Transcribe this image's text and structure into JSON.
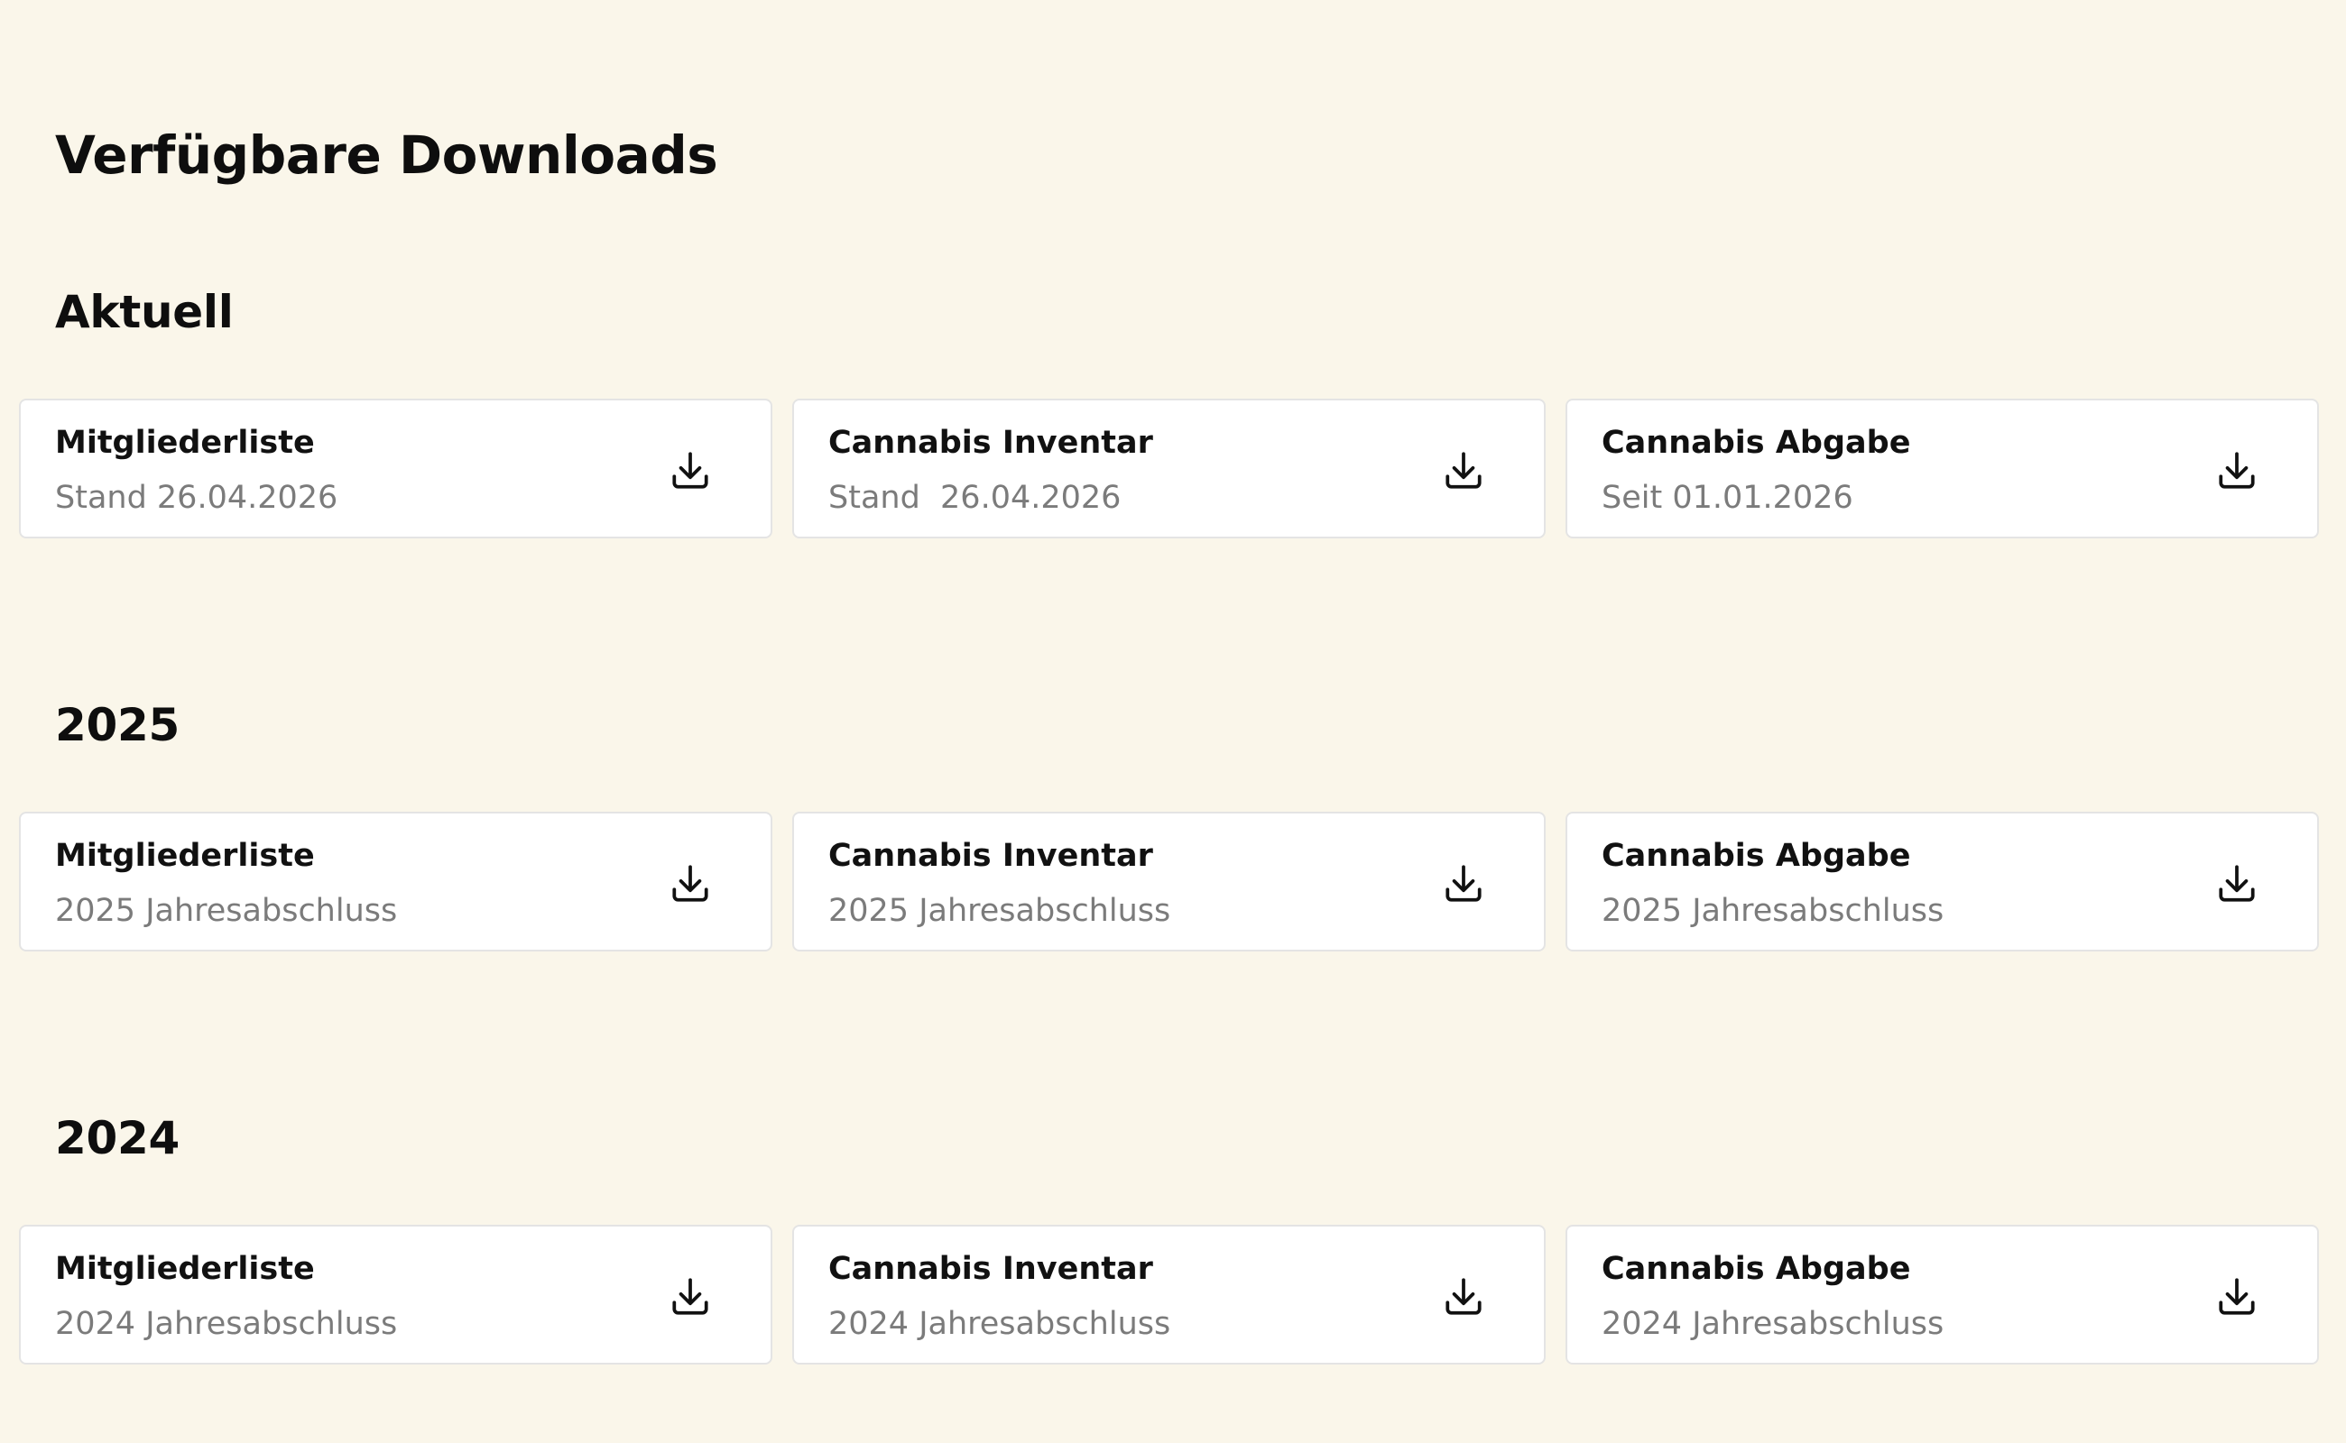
{
  "page": {
    "title": "Verfügbare Downloads"
  },
  "sections": [
    {
      "title": "Aktuell",
      "cards": [
        {
          "title": "Mitgliederliste",
          "subtitle": "Stand 26.04.2026",
          "icon": "download-icon"
        },
        {
          "title": "Cannabis Inventar",
          "subtitle": "Stand  26.04.2026",
          "icon": "download-icon"
        },
        {
          "title": "Cannabis Abgabe",
          "subtitle": "Seit 01.01.2026",
          "icon": "download-icon"
        }
      ]
    },
    {
      "title": "2025",
      "cards": [
        {
          "title": "Mitgliederliste",
          "subtitle": "2025 Jahresabschluss",
          "icon": "download-icon"
        },
        {
          "title": "Cannabis Inventar",
          "subtitle": "2025 Jahresabschluss",
          "icon": "download-icon"
        },
        {
          "title": "Cannabis Abgabe",
          "subtitle": "2025 Jahresabschluss",
          "icon": "download-icon"
        }
      ]
    },
    {
      "title": "2024",
      "cards": [
        {
          "title": "Mitgliederliste",
          "subtitle": "2024 Jahresabschluss",
          "icon": "download-icon"
        },
        {
          "title": "Cannabis Inventar",
          "subtitle": "2024 Jahresabschluss",
          "icon": "download-icon"
        },
        {
          "title": "Cannabis Abgabe",
          "subtitle": "2024 Jahresabschluss",
          "icon": "download-icon"
        }
      ]
    }
  ],
  "colors": {
    "background": "#faf6ea",
    "card_background": "#ffffff",
    "card_border": "#e4e4e4",
    "text_primary": "#111111",
    "text_secondary": "#7b7b7b"
  }
}
